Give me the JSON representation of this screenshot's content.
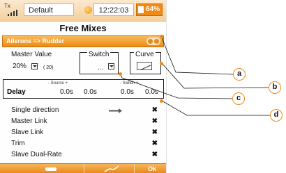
{
  "status": {
    "tx_label": "Tx",
    "profile": "Default",
    "time": "12:22:03",
    "battery": "64%"
  },
  "title": "Free Mixes",
  "mix": {
    "name": "Ailerons => Rudder"
  },
  "master": {
    "label": "Master Value",
    "value": "20%",
    "extra": "( 20)"
  },
  "switch": {
    "label": "Switch",
    "value": "..."
  },
  "curve": {
    "label": "Curve"
  },
  "delay": {
    "label": "Delay",
    "source_header": "- Source +",
    "switch_header": "- Switch +",
    "values": [
      "0.0s",
      "0.0s",
      "0.0s",
      "0.0s"
    ]
  },
  "options": [
    {
      "label": "Single direction",
      "mark": "✖"
    },
    {
      "label": "Master Link",
      "mark": "✖"
    },
    {
      "label": "Slave Link",
      "mark": "✖"
    },
    {
      "label": "Trim",
      "mark": "✖"
    },
    {
      "label": "Slave Dual-Rate",
      "mark": "✖"
    }
  ],
  "bottom": {
    "ok": "Ok"
  },
  "callouts": {
    "a": "a",
    "b": "b",
    "c": "c",
    "d": "d"
  },
  "colors": {
    "accent": "#f08a12",
    "status_bg": "#f3cf9b"
  }
}
